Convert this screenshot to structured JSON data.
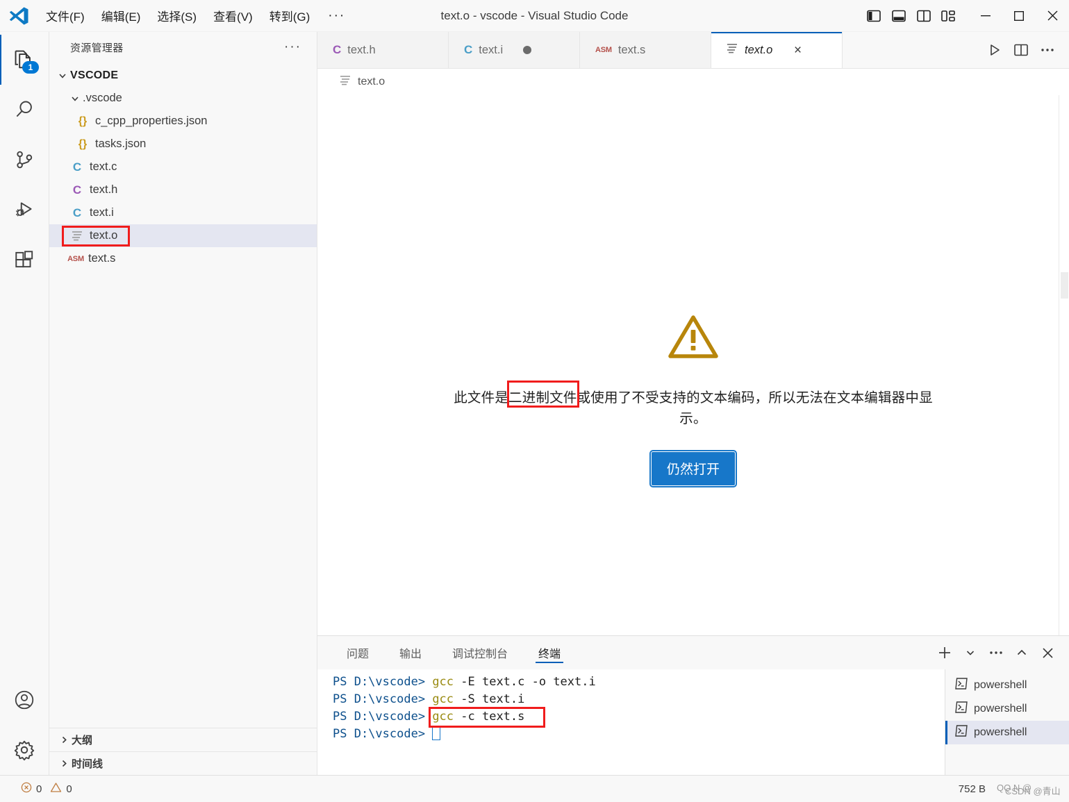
{
  "titlebar": {
    "logo_icon": "vscode-logo-icon",
    "title": "text.o - vscode - Visual Studio Code",
    "menus": [
      {
        "label": "文件(F)",
        "name": "menu-file"
      },
      {
        "label": "编辑(E)",
        "name": "menu-edit"
      },
      {
        "label": "选择(S)",
        "name": "menu-selection"
      },
      {
        "label": "查看(V)",
        "name": "menu-view"
      },
      {
        "label": "转到(G)",
        "name": "menu-go"
      }
    ],
    "menu_more": "···",
    "layout_buttons": [
      {
        "name": "toggle-primary-sidebar-icon"
      },
      {
        "name": "toggle-panel-icon"
      },
      {
        "name": "toggle-secondary-sidebar-icon"
      },
      {
        "name": "customize-layout-icon"
      }
    ],
    "window_buttons": {
      "minimize": "minimize-icon",
      "maximize": "maximize-icon",
      "close": "close-icon"
    }
  },
  "activitybar": {
    "items": [
      {
        "name": "activitybar-explorer",
        "icon": "files-icon",
        "badge": "1",
        "active": true
      },
      {
        "name": "activitybar-search",
        "icon": "search-icon",
        "badge": "",
        "active": false
      },
      {
        "name": "activitybar-source-control",
        "icon": "source-control-icon",
        "badge": "",
        "active": false
      },
      {
        "name": "activitybar-run-debug",
        "icon": "run-and-debug-icon",
        "badge": "",
        "active": false
      },
      {
        "name": "activitybar-extensions",
        "icon": "extensions-icon",
        "badge": "",
        "active": false
      }
    ],
    "bottom": [
      {
        "name": "activitybar-accounts",
        "icon": "account-icon"
      },
      {
        "name": "activitybar-settings",
        "icon": "gear-icon"
      }
    ]
  },
  "sidebar": {
    "header_title": "资源管理器",
    "header_more": "···",
    "tree": [
      {
        "label": "VSCODE",
        "kind": "root-folder",
        "indent": 0,
        "expanded": true,
        "selected": false
      },
      {
        "label": ".vscode",
        "kind": "folder",
        "indent": 1,
        "expanded": true,
        "selected": false
      },
      {
        "label": "c_cpp_properties.json",
        "kind": "json",
        "indent": 2,
        "expanded": null,
        "selected": false
      },
      {
        "label": "tasks.json",
        "kind": "json",
        "indent": 2,
        "expanded": null,
        "selected": false
      },
      {
        "label": "text.c",
        "kind": "c-blue",
        "indent": 1,
        "expanded": null,
        "selected": false
      },
      {
        "label": "text.h",
        "kind": "c-purple",
        "indent": 1,
        "expanded": null,
        "selected": false
      },
      {
        "label": "text.i",
        "kind": "c-blue",
        "indent": 1,
        "expanded": null,
        "selected": false
      },
      {
        "label": "text.o",
        "kind": "binary",
        "indent": 1,
        "expanded": null,
        "selected": true
      },
      {
        "label": "text.s",
        "kind": "asm",
        "indent": 1,
        "expanded": null,
        "selected": false
      }
    ],
    "sections": [
      {
        "label": "大纲",
        "name": "sidebar-section-outline"
      },
      {
        "label": "时间线",
        "name": "sidebar-section-timeline"
      }
    ]
  },
  "editor": {
    "tabs": [
      {
        "label": "text.h",
        "icon": "c-purple",
        "active": false,
        "dirty": false,
        "closable": false
      },
      {
        "label": "text.i",
        "icon": "c-blue",
        "active": false,
        "dirty": true,
        "closable": false
      },
      {
        "label": "text.s",
        "icon": "asm",
        "active": false,
        "dirty": false,
        "closable": false
      },
      {
        "label": "text.o",
        "icon": "binary",
        "active": true,
        "dirty": false,
        "closable": true
      }
    ],
    "tab_close_glyph": "×",
    "actions": [
      {
        "name": "run-code-icon"
      },
      {
        "name": "split-editor-right-icon"
      },
      {
        "name": "more-actions-icon"
      }
    ],
    "breadcrumb": "text.o",
    "binary_notice": {
      "warning_icon": "warning-triangle-icon",
      "message_prefix": "此文件是",
      "message_highlight": "二进制文件",
      "message_suffix": "或使用了不受支持的文本编码，所以无法在文本编辑器中显示。",
      "button_label": "仍然打开"
    }
  },
  "panel": {
    "tabs": [
      {
        "label": "问题",
        "name": "panel-tab-problems",
        "active": false
      },
      {
        "label": "输出",
        "name": "panel-tab-output",
        "active": false
      },
      {
        "label": "调试控制台",
        "name": "panel-tab-debug-console",
        "active": false
      },
      {
        "label": "终端",
        "name": "panel-tab-terminal",
        "active": true
      }
    ],
    "actions": [
      {
        "name": "new-terminal-icon",
        "glyph": "+"
      },
      {
        "name": "terminal-profile-chevron-down-icon",
        "glyph": "⌄"
      },
      {
        "name": "panel-more-actions-icon",
        "glyph": "···"
      },
      {
        "name": "maximize-panel-chevron-up-icon",
        "glyph": "^"
      },
      {
        "name": "close-panel-icon",
        "glyph": "×"
      }
    ],
    "terminal": {
      "prompt": "PS D:\\vscode>",
      "lines": [
        {
          "prompt": "PS D:\\vscode>",
          "cmd": "gcc",
          "args": " -E text.c -o text.i",
          "highlight": false
        },
        {
          "prompt": "PS D:\\vscode>",
          "cmd": "gcc",
          "args": " -S text.i",
          "highlight": false
        },
        {
          "prompt": "PS D:\\vscode>",
          "cmd": "gcc",
          "args": " -c text.s",
          "highlight": true
        },
        {
          "prompt": "PS D:\\vscode>",
          "cmd": "",
          "args": "",
          "highlight": false
        }
      ],
      "instances": [
        {
          "label": "powershell",
          "icon": "terminal-icon",
          "active": false
        },
        {
          "label": "powershell",
          "icon": "terminal-icon",
          "active": false
        },
        {
          "label": "powershell",
          "icon": "terminal-icon",
          "active": true
        }
      ]
    }
  },
  "statusbar": {
    "error_icon": "error-circle-icon",
    "error_count": "0",
    "warning_icon": "warning-triangle-icon",
    "warning_count": "0",
    "file_size": "752 B",
    "watermark_a": "CSDN @青山",
    "watermark_b": "QQ N @"
  },
  "colors": {
    "accent": "#005fb8",
    "button_blue": "#1777c9",
    "warning": "#b8860b",
    "annotation_red": "#f01c1c",
    "selection": "#e4e6f1",
    "c_blue": "#4a9ec7",
    "c_purple": "#9b59b6",
    "asm_red": "#b4504a",
    "json_yellow": "#cb9b1e"
  }
}
